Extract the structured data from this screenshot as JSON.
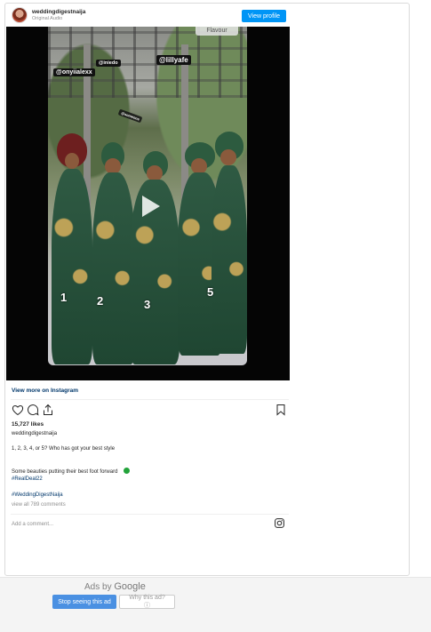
{
  "post": {
    "account": "weddingdigestnaija",
    "audio": "Original Audio",
    "view_profile": "View profile",
    "view_more": "View more on Instagram",
    "likes": "15,727 likes",
    "caption_account": "weddingdigestnaija",
    "caption_line1": "1, 2, 3, 4, or 5? Who has got your best style",
    "caption_line2": "Some beauties putting their best foot forward",
    "hashtag1": "#RealDeal22",
    "hashtag2": "#WeddingDigestNaija",
    "view_comments": "view all 789 comments",
    "add_comment": "Add a comment..."
  },
  "video": {
    "watermark": "Flavour",
    "tags": [
      "@onyiialexx",
      "@iniedo",
      "@lillyafe"
    ],
    "small_tag": "@someone",
    "numbers": [
      "1",
      "2",
      "3",
      "5"
    ]
  },
  "ad": {
    "ads_by": "Ads by",
    "google": "Google",
    "stop_label": "Stop seeing this ad",
    "why_label": "Why this ad? ⓘ"
  },
  "colors": {
    "accent_blue": "#0095f6",
    "link_blue": "#00376b",
    "gown_green": "#1f4632",
    "ad_blue": "#4a90e2"
  },
  "icons": [
    "heart-icon",
    "comment-icon",
    "share-icon",
    "bookmark-icon",
    "instagram-icon",
    "play-icon"
  ]
}
